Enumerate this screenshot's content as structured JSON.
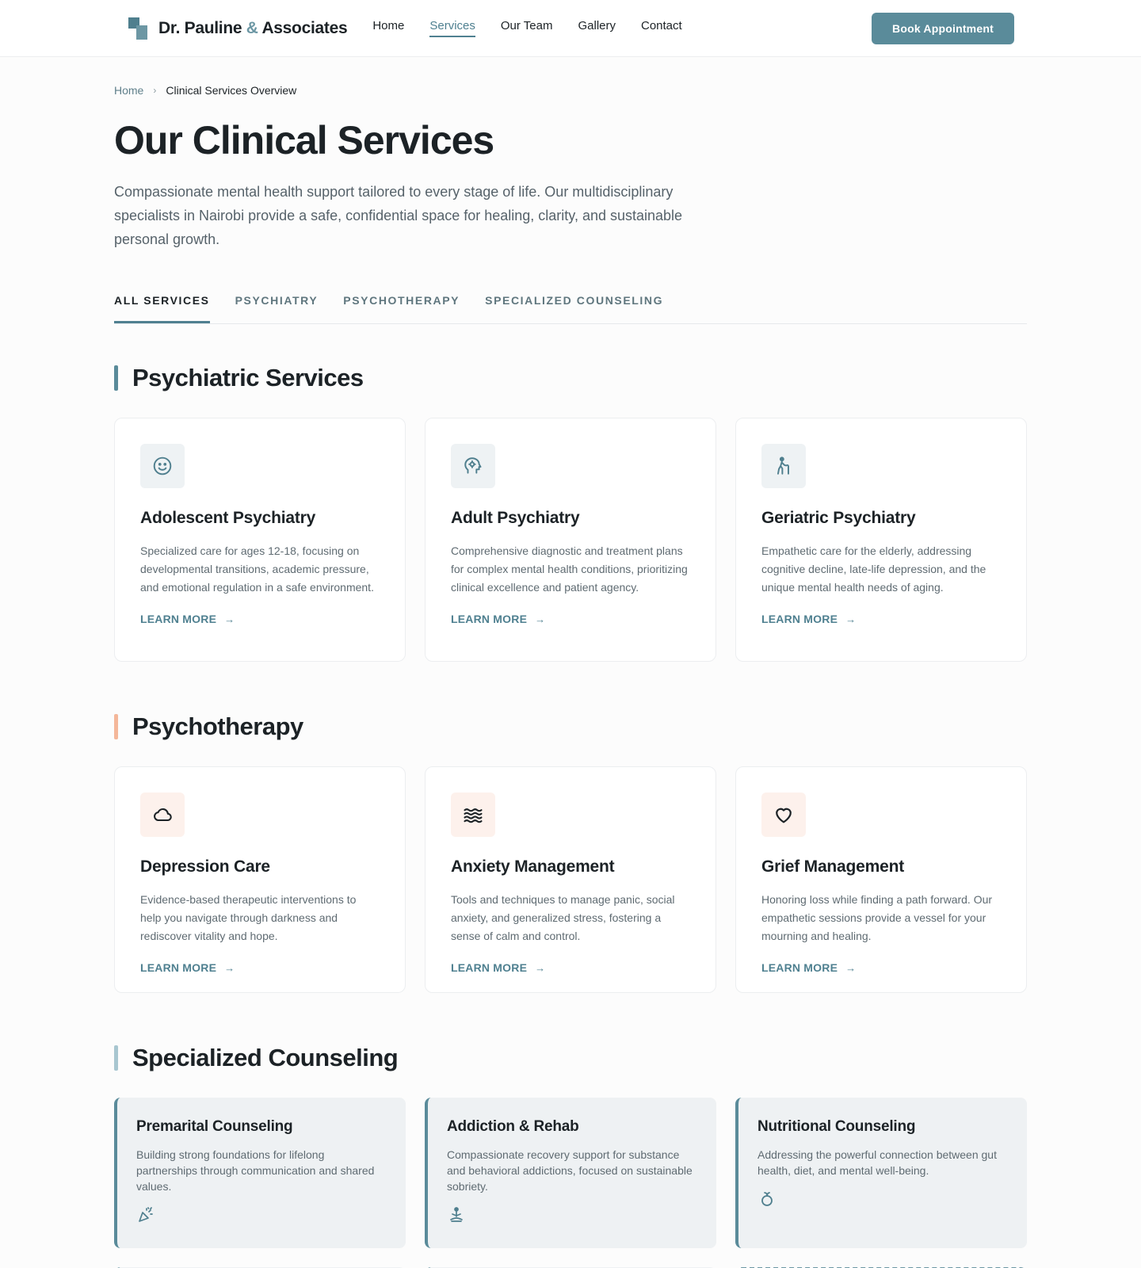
{
  "header": {
    "brand_name": "Dr. Pauline",
    "brand_amp": "&",
    "brand_suffix": "Associates",
    "nav": [
      {
        "label": "Home"
      },
      {
        "label": "Services"
      },
      {
        "label": "Our Team"
      },
      {
        "label": "Gallery"
      },
      {
        "label": "Contact"
      }
    ],
    "active_nav": "Services",
    "cta_label": "Book Appointment"
  },
  "breadcrumb": {
    "home": "Home",
    "separator": "›",
    "current": "Clinical Services Overview"
  },
  "page": {
    "title": "Our Clinical Services",
    "intro": "Compassionate mental health support tailored to every stage of life. Our multidisciplinary specialists in Nairobi provide a safe, confidential space for healing, clarity, and sustainable personal growth."
  },
  "tabs": [
    {
      "label": "ALL SERVICES"
    },
    {
      "label": "PSYCHIATRY"
    },
    {
      "label": "PSYCHOTHERAPY"
    },
    {
      "label": "SPECIALIZED COUNSELING"
    }
  ],
  "active_tab": "ALL SERVICES",
  "learn_more_label": "LEARN MORE",
  "arrow_glyph": "→",
  "sections": {
    "psychiatric": {
      "title": "Psychiatric Services",
      "cards": [
        {
          "icon": "smile-icon",
          "title": "Adolescent Psychiatry",
          "desc": "Specialized care for ages 12-18, focusing on developmental transitions, academic pressure, and emotional regulation in a safe environment."
        },
        {
          "icon": "head-gear-icon",
          "title": "Adult Psychiatry",
          "desc": "Comprehensive diagnostic and treatment plans for complex mental health conditions, prioritizing clinical excellence and patient agency."
        },
        {
          "icon": "elderly-walking-icon",
          "title": "Geriatric Psychiatry",
          "desc": "Empathetic care for the elderly, addressing cognitive decline, late-life depression, and the unique mental health needs of aging."
        }
      ]
    },
    "psychotherapy": {
      "title": "Psychotherapy",
      "cards": [
        {
          "icon": "cloud-icon",
          "title": "Depression Care",
          "desc": "Evidence-based therapeutic interventions to help you navigate through darkness and rediscover vitality and hope."
        },
        {
          "icon": "waves-icon",
          "title": "Anxiety Management",
          "desc": "Tools and techniques to manage panic, social anxiety, and generalized stress, fostering a sense of calm and control."
        },
        {
          "icon": "heart-icon",
          "title": "Grief Management",
          "desc": "Honoring loss while finding a path forward. Our empathetic sessions provide a vessel for your mourning and healing."
        }
      ]
    },
    "specialized": {
      "title": "Specialized Counseling",
      "cards": [
        {
          "icon": "celebration-icon",
          "title": "Premarital Counseling",
          "desc": "Building strong foundations for lifelong partnerships through communication and shared values."
        },
        {
          "icon": "meditation-icon",
          "title": "Addiction & Rehab",
          "desc": "Compassionate recovery support for substance and behavioral addictions, focused on sustainable sobriety."
        },
        {
          "icon": "nutrition-icon",
          "title": "Nutritional Counseling",
          "desc": "Addressing the powerful connection between gut health, diet, and mental well-being."
        }
      ]
    }
  },
  "colors": {
    "accent": "#5a8b9a",
    "accent_dark": "#4f8090",
    "peach": "#f4b79a",
    "text": "#1c2226"
  }
}
